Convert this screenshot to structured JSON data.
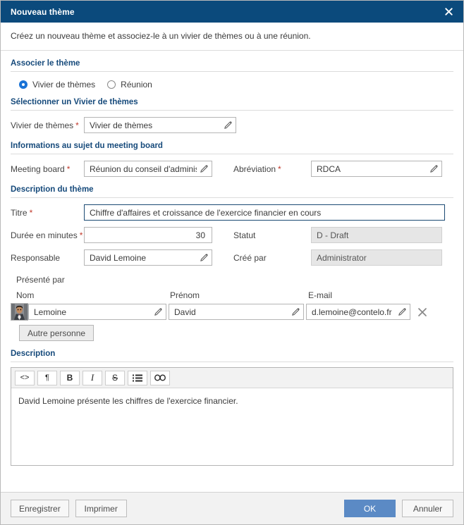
{
  "window": {
    "title": "Nouveau thème",
    "close_icon": "close-icon",
    "intro": "Créez un nouveau thème et associez-le à un vivier de thèmes ou à une réunion."
  },
  "sections": {
    "associate": {
      "title": "Associer le thème",
      "options": [
        {
          "label": "Vivier de thèmes",
          "selected": true
        },
        {
          "label": "Réunion",
          "selected": false
        }
      ]
    },
    "select_pool": {
      "title": "Sélectionner un Vivier de thèmes",
      "field_label": "Vivier de thèmes",
      "required_mark": "*",
      "field_value": "Vivier de thèmes"
    },
    "meeting_board": {
      "title": "Informations au sujet du meeting board",
      "board_label": "Meeting board",
      "board_value": "Réunion du conseil d'administra",
      "abbrev_label": "Abréviation",
      "abbrev_value": "RDCA"
    },
    "theme_description": {
      "title": "Description du thème",
      "titre_label": "Titre",
      "titre_value": "Chiffre d'affaires et croissance de l'exercice financier en cours",
      "duree_label": "Durée en minutes",
      "duree_value": "30",
      "statut_label": "Statut",
      "statut_value": "D - Draft",
      "responsable_label": "Responsable",
      "responsable_value": "David Lemoine",
      "cree_par_label": "Créé par",
      "cree_par_value": "Administrator"
    },
    "presented_by": {
      "title": "Présenté par",
      "columns": [
        "Nom",
        "Prénom",
        "E-mail"
      ],
      "rows": [
        {
          "avatar": "user-avatar",
          "nom": "Lemoine",
          "prenom": "David",
          "email": "d.lemoine@contelo.fr",
          "delete_icon": "delete-icon"
        }
      ],
      "add_button": "Autre personne"
    },
    "description": {
      "title": "Description",
      "toolbar": [
        {
          "name": "source-code-icon",
          "glyph": "<>"
        },
        {
          "name": "paragraph-icon",
          "glyph": "¶"
        },
        {
          "name": "bold-icon",
          "glyph": "B"
        },
        {
          "name": "italic-icon",
          "glyph": "I"
        },
        {
          "name": "strikethrough-icon",
          "glyph": "S"
        },
        {
          "name": "bullet-list-icon",
          "glyph": ""
        },
        {
          "name": "link-icon",
          "glyph": ""
        }
      ],
      "content": "David Lemoine présente les chiffres de l'exercice financier."
    }
  },
  "footer": {
    "save_label": "Enregistrer",
    "print_label": "Imprimer",
    "ok_label": "OK",
    "cancel_label": "Annuler"
  },
  "colors": {
    "titlebar": "#0b4a7c",
    "section_heading": "#164a7b",
    "radio_accent": "#1a73d6",
    "required": "#c0392b",
    "primary_button": "#5b8ac5",
    "focused_border": "#1b4a73",
    "readonly_bg": "#e6e6e6"
  }
}
